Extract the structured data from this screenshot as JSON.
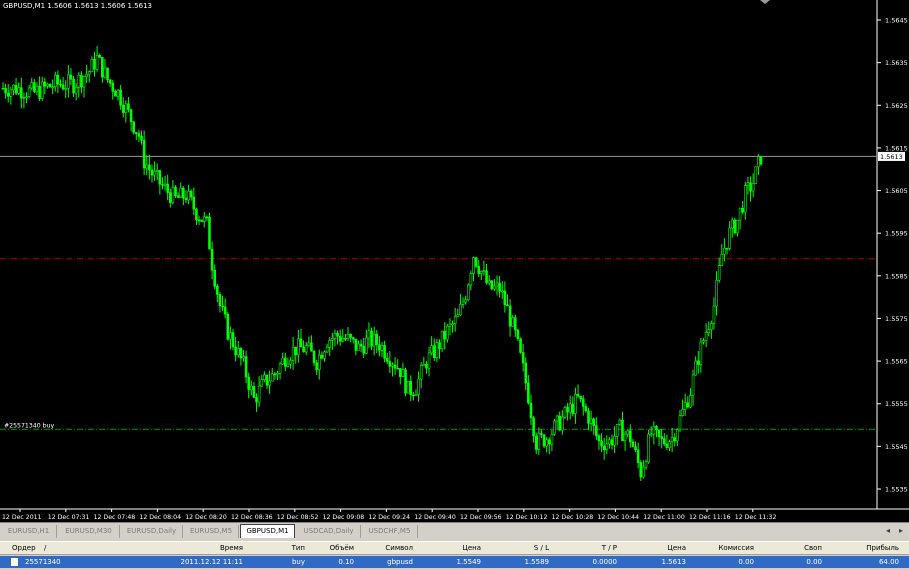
{
  "chart": {
    "info": "GBPUSD,M1  1.5606 1.5613 1.5606 1.5613",
    "current_price_label": "1.5613",
    "order_label": "#25571340 buy",
    "colors": {
      "bull": "#00ff00",
      "bear": "#00ff00",
      "bid_line": "#8aa28a",
      "sl_line": "#b40000",
      "order_line": "#00a000"
    },
    "price_ticks": [
      "1.5645",
      "1.5635",
      "1.5625",
      "1.5615",
      "1.5605",
      "1.5595",
      "1.5585",
      "1.5575",
      "1.5565",
      "1.5555",
      "1.5545",
      "1.5535"
    ],
    "time_ticks": [
      "12 Dec 2011",
      "12 Dec 07:31",
      "12 Dec 07:48",
      "12 Dec 08:04",
      "12 Dec 08:20",
      "12 Dec 08:36",
      "12 Dec 08:52",
      "12 Dec 09:08",
      "12 Dec 09:24",
      "12 Dec 09:40",
      "12 Dec 09:56",
      "12 Dec 10:12",
      "12 Dec 10:28",
      "12 Dec 10:44",
      "12 Dec 11:00",
      "12 Dec 11:16",
      "12 Dec 11:32"
    ]
  },
  "chart_data": {
    "type": "candlestick",
    "title": "GBPUSD,M1",
    "ylim": [
      1.553,
      1.565
    ],
    "bid": 1.5613,
    "stop_loss": 1.5589,
    "order_price": 1.5549,
    "close_path": [
      [
        0,
        1.5629
      ],
      [
        5,
        1.5629
      ],
      [
        12,
        1.5628
      ],
      [
        20,
        1.563
      ],
      [
        27,
        1.563
      ],
      [
        33,
        1.5633
      ],
      [
        36,
        1.5636
      ],
      [
        40,
        1.5631
      ],
      [
        44,
        1.5628
      ],
      [
        48,
        1.5623
      ],
      [
        52,
        1.5618
      ],
      [
        54,
        1.5612
      ],
      [
        57,
        1.5609
      ],
      [
        61,
        1.5606
      ],
      [
        66,
        1.5603
      ],
      [
        70,
        1.5604
      ],
      [
        74,
        1.56
      ],
      [
        78,
        1.5597
      ],
      [
        80,
        1.5588
      ],
      [
        83,
        1.5578
      ],
      [
        86,
        1.5572
      ],
      [
        89,
        1.5568
      ],
      [
        92,
        1.5564
      ],
      [
        96,
        1.5556
      ],
      [
        100,
        1.556
      ],
      [
        104,
        1.5562
      ],
      [
        108,
        1.5566
      ],
      [
        112,
        1.5568
      ],
      [
        116,
        1.5568
      ],
      [
        120,
        1.5565
      ],
      [
        124,
        1.557
      ],
      [
        128,
        1.5571
      ],
      [
        132,
        1.557
      ],
      [
        136,
        1.5568
      ],
      [
        140,
        1.557
      ],
      [
        144,
        1.5569
      ],
      [
        148,
        1.5566
      ],
      [
        152,
        1.5563
      ],
      [
        155,
        1.5558
      ],
      [
        158,
        1.5559
      ],
      [
        162,
        1.5565
      ],
      [
        166,
        1.5568
      ],
      [
        170,
        1.5572
      ],
      [
        174,
        1.5575
      ],
      [
        177,
        1.5581
      ],
      [
        180,
        1.559
      ],
      [
        183,
        1.5586
      ],
      [
        186,
        1.5582
      ],
      [
        190,
        1.5582
      ],
      [
        193,
        1.5577
      ],
      [
        196,
        1.5571
      ],
      [
        199,
        1.5563
      ],
      [
        201,
        1.5557
      ],
      [
        204,
        1.5546
      ],
      [
        208,
        1.5547
      ],
      [
        212,
        1.555
      ],
      [
        216,
        1.5553
      ],
      [
        220,
        1.5556
      ],
      [
        224,
        1.5552
      ],
      [
        228,
        1.5546
      ],
      [
        232,
        1.5546
      ],
      [
        236,
        1.5549
      ],
      [
        240,
        1.5547
      ],
      [
        244,
        1.5539
      ],
      [
        248,
        1.5548
      ],
      [
        252,
        1.5546
      ],
      [
        256,
        1.5547
      ],
      [
        260,
        1.5553
      ],
      [
        263,
        1.5558
      ],
      [
        266,
        1.5566
      ],
      [
        269,
        1.5572
      ],
      [
        272,
        1.5578
      ],
      [
        275,
        1.559
      ],
      [
        278,
        1.5595
      ],
      [
        281,
        1.5598
      ],
      [
        284,
        1.5604
      ],
      [
        287,
        1.5607
      ],
      [
        290,
        1.5613
      ]
    ],
    "bars": 290
  },
  "tabs": [
    {
      "label": "EURUSD,H1",
      "active": false
    },
    {
      "label": "EURUSD,M30",
      "active": false
    },
    {
      "label": "EURUSD,Daily",
      "active": false
    },
    {
      "label": "EURUSD,M5",
      "active": false
    },
    {
      "label": "GBPUSD,M1",
      "active": true
    },
    {
      "label": "USDCAD,Daily",
      "active": false
    },
    {
      "label": "USDCHF,M5",
      "active": false
    }
  ],
  "terminal": {
    "headers": {
      "order": "Ордер",
      "sort": "/",
      "time": "Время",
      "type": "Тип",
      "volume": "Объём",
      "symbol": "Символ",
      "price": "Цена",
      "sl": "S / L",
      "tp": "T / P",
      "cur_price": "Цена",
      "commission": "Комиссия",
      "swap": "Своп",
      "profit": "Прибыль"
    },
    "row": {
      "order": "25571340",
      "time": "2011.12.12 11:11",
      "type": "buy",
      "volume": "0.10",
      "symbol": "gbpusd",
      "price": "1.5549",
      "sl": "1.5589",
      "tp": "0.0000",
      "cur_price": "1.5613",
      "commission": "0.00",
      "swap": "0.00",
      "profit": "64.00"
    }
  }
}
